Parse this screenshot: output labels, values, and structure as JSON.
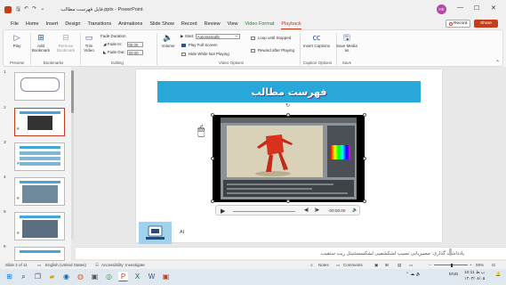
{
  "window": {
    "title": "فایل فهرست مطالب.pptx - PowerPoint",
    "user_initials": "HE",
    "record_label": "Record",
    "share_label": "Share",
    "minimize": "—",
    "maximize": "☐",
    "close": "✕"
  },
  "tabs": [
    {
      "label": "File"
    },
    {
      "label": "Home"
    },
    {
      "label": "Insert"
    },
    {
      "label": "Design"
    },
    {
      "label": "Transitions"
    },
    {
      "label": "Animations"
    },
    {
      "label": "Slide Show"
    },
    {
      "label": "Record"
    },
    {
      "label": "Review"
    },
    {
      "label": "View"
    },
    {
      "label": "Video Format"
    },
    {
      "label": "Playback"
    }
  ],
  "ribbon": {
    "preview": {
      "play_label": "Play",
      "group": "Preview"
    },
    "bookmarks": {
      "add_label": "Add Bookmark",
      "remove_label": "Remove Bookmark",
      "group": "Bookmarks"
    },
    "editing": {
      "trim_label": "Trim Video",
      "fade_duration_label": "Fade Duration",
      "fade_in_label": "Fade In:",
      "fade_in_value": "00.00",
      "fade_out_label": "Fade Out:",
      "fade_out_value": "00.00",
      "group": "Editing"
    },
    "video_options": {
      "volume_label": "Volume",
      "start_label": "Start:",
      "start_value": "Automatically",
      "play_full_screen": "Play Full Screen",
      "hide_while_not_playing": "Hide While Not Playing",
      "loop_until_stopped": "Loop until Stopped",
      "rewind_after_playing": "Rewind after Playing",
      "group": "Video Options"
    },
    "caption_options": {
      "insert_captions_label": "Insert Captions",
      "group": "Caption Options"
    },
    "save": {
      "save_media_label": "Save Media as",
      "group": "Save"
    }
  },
  "slides_panel": {
    "thumbnails": [
      {
        "number": "1"
      },
      {
        "number": "2"
      },
      {
        "number": "3"
      },
      {
        "number": "4"
      },
      {
        "number": "5"
      },
      {
        "number": "6"
      }
    ]
  },
  "slide": {
    "title": "فهرست مطالب",
    "ai_text": "AI",
    "video_time": "-00:00.00"
  },
  "notes": {
    "text": "یادداشت گذاری: مسیریابی تسیپ لشکشمیی لشکسستتیتل ریب ستفیب."
  },
  "statusbar": {
    "slide_info": "Slide 2 of 11",
    "language": "English (United States)",
    "accessibility": "Accessibility: Investigate",
    "notes_label": "Notes",
    "comments_label": "Comments",
    "zoom": "59%"
  },
  "taskbar": {
    "language": "ENG",
    "time": "10:11 ب.ظ",
    "date": "۱۴۰۳/۰۸/۰۵"
  },
  "colors": {
    "accent": "#c43e1c",
    "title_bar": "#27a8d8",
    "video_format_tab": "#2e7d32"
  }
}
